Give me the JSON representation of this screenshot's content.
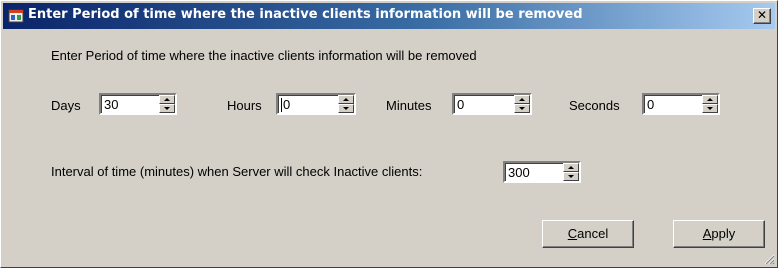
{
  "window": {
    "title": "Enter Period of time where the inactive clients information will be  removed",
    "close_glyph": "✕"
  },
  "dialog": {
    "instruction": "Enter Period of time where the inactive clients information will be  removed",
    "days": {
      "label": "Days",
      "value": "30"
    },
    "hours": {
      "label": "Hours",
      "value": "0"
    },
    "minutes": {
      "label": "Minutes",
      "value": "0"
    },
    "seconds": {
      "label": "Seconds",
      "value": "0"
    },
    "interval": {
      "label": "Interval of time (minutes)  when Server will check Inactive clients:",
      "value": "300"
    }
  },
  "buttons": {
    "cancel": {
      "mnemonic": "C",
      "rest": "ancel"
    },
    "apply": {
      "mnemonic": "A",
      "rest": "pply"
    }
  },
  "icons": {
    "app": "app-window-icon",
    "close": "close-icon",
    "spin_up": "spin-up-arrow-icon",
    "spin_down": "spin-down-arrow-icon",
    "resize": "resize-grip-icon"
  }
}
